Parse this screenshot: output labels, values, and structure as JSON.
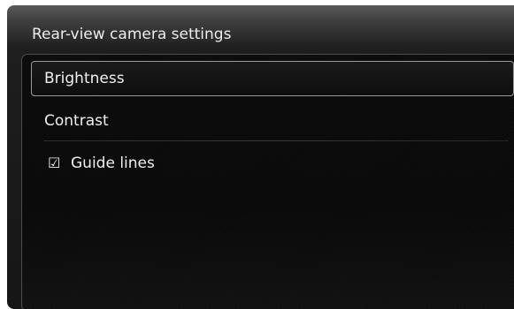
{
  "window": {
    "title": "Rear-view camera settings"
  },
  "menu": {
    "items": [
      {
        "label": "Brightness",
        "selected": true
      },
      {
        "label": "Contrast",
        "selected": false
      },
      {
        "label": "Guide lines",
        "checked": true,
        "icon": "checkbox-checked-icon",
        "glyph": "☑"
      }
    ]
  }
}
